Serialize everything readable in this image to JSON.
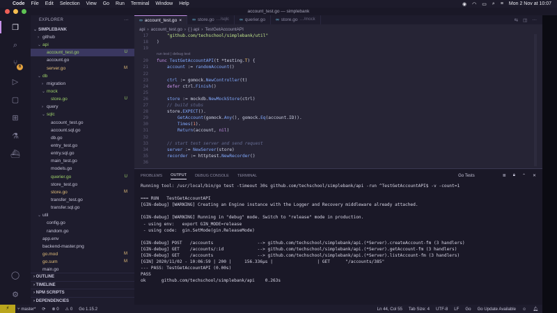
{
  "mac_menubar": {
    "app_name": "Code",
    "items": [
      "File",
      "Edit",
      "Selection",
      "View",
      "Go",
      "Run",
      "Terminal",
      "Window",
      "Help"
    ],
    "clock": "Mon 2 Nov at 10:07"
  },
  "window": {
    "title": "account_test.go — simplebank"
  },
  "sidebar": {
    "title": "EXPLORER",
    "project": "SIMPLEBANK",
    "tree": [
      {
        "label": "github",
        "arrow": "›",
        "indent": 1,
        "status": "",
        "color": "#c6c4d8"
      },
      {
        "label": "api",
        "arrow": "⌄",
        "indent": 1,
        "status": "",
        "color": "#9fd36a"
      },
      {
        "label": "account_test.go",
        "arrow": "",
        "indent": 2,
        "status": "U",
        "color": "#9fd36a",
        "selected": true
      },
      {
        "label": "account.go",
        "arrow": "",
        "indent": 2,
        "status": "",
        "color": "#c6c4d8"
      },
      {
        "label": "server.go",
        "arrow": "",
        "indent": 2,
        "status": "M",
        "color": "#e5c07b"
      },
      {
        "label": "db",
        "arrow": "⌄",
        "indent": 1,
        "status": "",
        "color": "#9fd36a"
      },
      {
        "label": "migration",
        "arrow": "›",
        "indent": 2,
        "status": "",
        "color": "#c6c4d8"
      },
      {
        "label": "mock",
        "arrow": "⌄",
        "indent": 2,
        "status": "",
        "color": "#9fd36a"
      },
      {
        "label": "store.go",
        "arrow": "",
        "indent": 3,
        "status": "U",
        "color": "#9fd36a"
      },
      {
        "label": "query",
        "arrow": "›",
        "indent": 2,
        "status": "",
        "color": "#c6c4d8"
      },
      {
        "label": "sqlc",
        "arrow": "⌄",
        "indent": 2,
        "status": "",
        "color": "#9fd36a"
      },
      {
        "label": "account_test.go",
        "arrow": "",
        "indent": 3,
        "status": "",
        "color": "#c6c4d8"
      },
      {
        "label": "account.sql.go",
        "arrow": "",
        "indent": 3,
        "status": "",
        "color": "#c6c4d8"
      },
      {
        "label": "db.go",
        "arrow": "",
        "indent": 3,
        "status": "",
        "color": "#c6c4d8"
      },
      {
        "label": "entry_test.go",
        "arrow": "",
        "indent": 3,
        "status": "",
        "color": "#c6c4d8"
      },
      {
        "label": "entry.sql.go",
        "arrow": "",
        "indent": 3,
        "status": "",
        "color": "#c6c4d8"
      },
      {
        "label": "main_test.go",
        "arrow": "",
        "indent": 3,
        "status": "",
        "color": "#c6c4d8"
      },
      {
        "label": "models.go",
        "arrow": "",
        "indent": 3,
        "status": "",
        "color": "#c6c4d8"
      },
      {
        "label": "querier.go",
        "arrow": "",
        "indent": 3,
        "status": "U",
        "color": "#9fd36a"
      },
      {
        "label": "store_test.go",
        "arrow": "",
        "indent": 3,
        "status": "",
        "color": "#c6c4d8"
      },
      {
        "label": "store.go",
        "arrow": "",
        "indent": 3,
        "status": "M",
        "color": "#e5c07b"
      },
      {
        "label": "transfer_test.go",
        "arrow": "",
        "indent": 3,
        "status": "",
        "color": "#c6c4d8"
      },
      {
        "label": "transfer.sql.go",
        "arrow": "",
        "indent": 3,
        "status": "",
        "color": "#c6c4d8"
      },
      {
        "label": "util",
        "arrow": "⌄",
        "indent": 1,
        "status": "",
        "color": "#c6c4d8"
      },
      {
        "label": "config.go",
        "arrow": "",
        "indent": 2,
        "status": "",
        "color": "#c6c4d8"
      },
      {
        "label": "random.go",
        "arrow": "",
        "indent": 2,
        "status": "",
        "color": "#c6c4d8"
      },
      {
        "label": "app.env",
        "arrow": "",
        "indent": 1,
        "status": "",
        "color": "#c6c4d8"
      },
      {
        "label": "backend-master.png",
        "arrow": "",
        "indent": 1,
        "status": "",
        "color": "#c6c4d8"
      },
      {
        "label": "go.mod",
        "arrow": "",
        "indent": 1,
        "status": "M",
        "color": "#e5c07b"
      },
      {
        "label": "go.sum",
        "arrow": "",
        "indent": 1,
        "status": "M",
        "color": "#e5c07b"
      },
      {
        "label": "main.go",
        "arrow": "",
        "indent": 1,
        "status": "",
        "color": "#c6c4d8"
      }
    ],
    "sections": [
      "OUTLINE",
      "TIMELINE",
      "NPM SCRIPTS",
      "DEPENDENCIES"
    ]
  },
  "activity_bar": {
    "scm_badge": "6"
  },
  "editor": {
    "tabs": [
      {
        "label": "account_test.go",
        "hint": "",
        "active": true
      },
      {
        "label": "store.go",
        "hint": "…/sqlc",
        "active": false
      },
      {
        "label": "querier.go",
        "hint": "",
        "active": false
      },
      {
        "label": "store.go",
        "hint": "…/mock",
        "active": false
      }
    ],
    "breadcrumbs": [
      "api",
      "account_test.go",
      "{ } api",
      "TestGetAccountAPI"
    ],
    "codelens": "run test | debug test",
    "lines": [
      {
        "n": "17",
        "html": "    <span class=\"str\">\"github.com/techschool/simplebank/util\"</span>"
      },
      {
        "n": "18",
        "html": ")"
      },
      {
        "n": "19",
        "html": ""
      },
      {
        "n": "",
        "lens": true
      },
      {
        "n": "20",
        "html": "<span class=\"kw\">func</span> <span class=\"fn\">TestGetAccountAPI</span>(t *testing.<span class=\"ty\">T</span>) {"
      },
      {
        "n": "21",
        "html": "    <span class=\"vr\">account</span> := <span class=\"fn\">randomAccount</span>()"
      },
      {
        "n": "22",
        "html": ""
      },
      {
        "n": "23",
        "html": "    <span class=\"vr\">ctrl</span> := gomock.<span class=\"fn\">NewController</span>(t)"
      },
      {
        "n": "24",
        "html": "    <span class=\"kw\">defer</span> ctrl.<span class=\"fn\">Finish</span>()"
      },
      {
        "n": "25",
        "html": ""
      },
      {
        "n": "26",
        "html": "    <span class=\"vr\">store</span> := mockdb.<span class=\"fn\">NewMockStore</span>(ctrl)"
      },
      {
        "n": "27",
        "html": "    <span class=\"cm\">// build stubs</span>"
      },
      {
        "n": "28",
        "html": "    store.<span class=\"fn\">EXPECT</span>()."
      },
      {
        "n": "29",
        "html": "        <span class=\"fn\">GetAccount</span>(gomock.<span class=\"fn\">Any</span>(), gomock.<span class=\"fn\">Eq</span>(account.ID))."
      },
      {
        "n": "30",
        "html": "        <span class=\"fn\">Times</span>(<span class=\"num-l\">1</span>)."
      },
      {
        "n": "31",
        "html": "        <span class=\"fn\">Return</span>(account, <span class=\"kw\">nil</span>)"
      },
      {
        "n": "32",
        "html": ""
      },
      {
        "n": "33",
        "html": "    <span class=\"cm\">// start test server and send request</span>"
      },
      {
        "n": "34",
        "html": "    <span class=\"vr\">server</span> := <span class=\"fn\">NewServer</span>(store)"
      },
      {
        "n": "35",
        "html": "    <span class=\"vr\">recorder</span> := httptest.<span class=\"fn\">NewRecorder</span>()"
      },
      {
        "n": "36",
        "html": ""
      }
    ]
  },
  "panel": {
    "tabs": [
      "PROBLEMS",
      "OUTPUT",
      "DEBUG CONSOLE",
      "TERMINAL"
    ],
    "active_tab": "OUTPUT",
    "channel": "Go Tests",
    "lines": [
      "Running tool: /usr/local/bin/go test -timeout 30s github.com/techschool/simplebank/api -run ^TestGetAccountAPI$ -v -count=1",
      "",
      "=== RUN   TestGetAccountAPI",
      "[GIN-debug] [WARNING] Creating an Engine instance with the Logger and Recovery middleware already attached.",
      "",
      "[GIN-debug] [WARNING] Running in \"debug\" mode. Switch to \"release\" mode in production.",
      " - using env:   export GIN_MODE=release",
      " - using code:  gin.SetMode(gin.ReleaseMode)",
      "",
      "[GIN-debug] POST   /accounts                 --> github.com/techschool/simplebank/api.(*Server).createAccount-fm (3 handlers)",
      "[GIN-debug] GET    /accounts/:id             --> github.com/techschool/simplebank/api.(*Server).getAccount-fm (3 handlers)",
      "[GIN-debug] GET    /accounts                 --> github.com/techschool/simplebank/api.(*Server).listAccount-fm (3 handlers)",
      "[GIN] 2020/11/02 - 10:06:59 | 200 |     156.336µs |                 | GET      \"/accounts/385\"",
      "--- PASS: TestGetAccountAPI (0.00s)",
      "PASS",
      "ok      github.com/techschool/simplebank/api    0.263s"
    ]
  },
  "statusbar": {
    "branch": "master*",
    "sync": "⟳",
    "errors": "⊗ 0",
    "warnings": "⚠ 0",
    "go_version": "Go 1.15.2",
    "position": "Ln 44, Col 55",
    "tab_size": "Tab Size: 4",
    "encoding": "UTF-8",
    "eol": "LF",
    "language": "Go",
    "update": "Go Update Available"
  }
}
